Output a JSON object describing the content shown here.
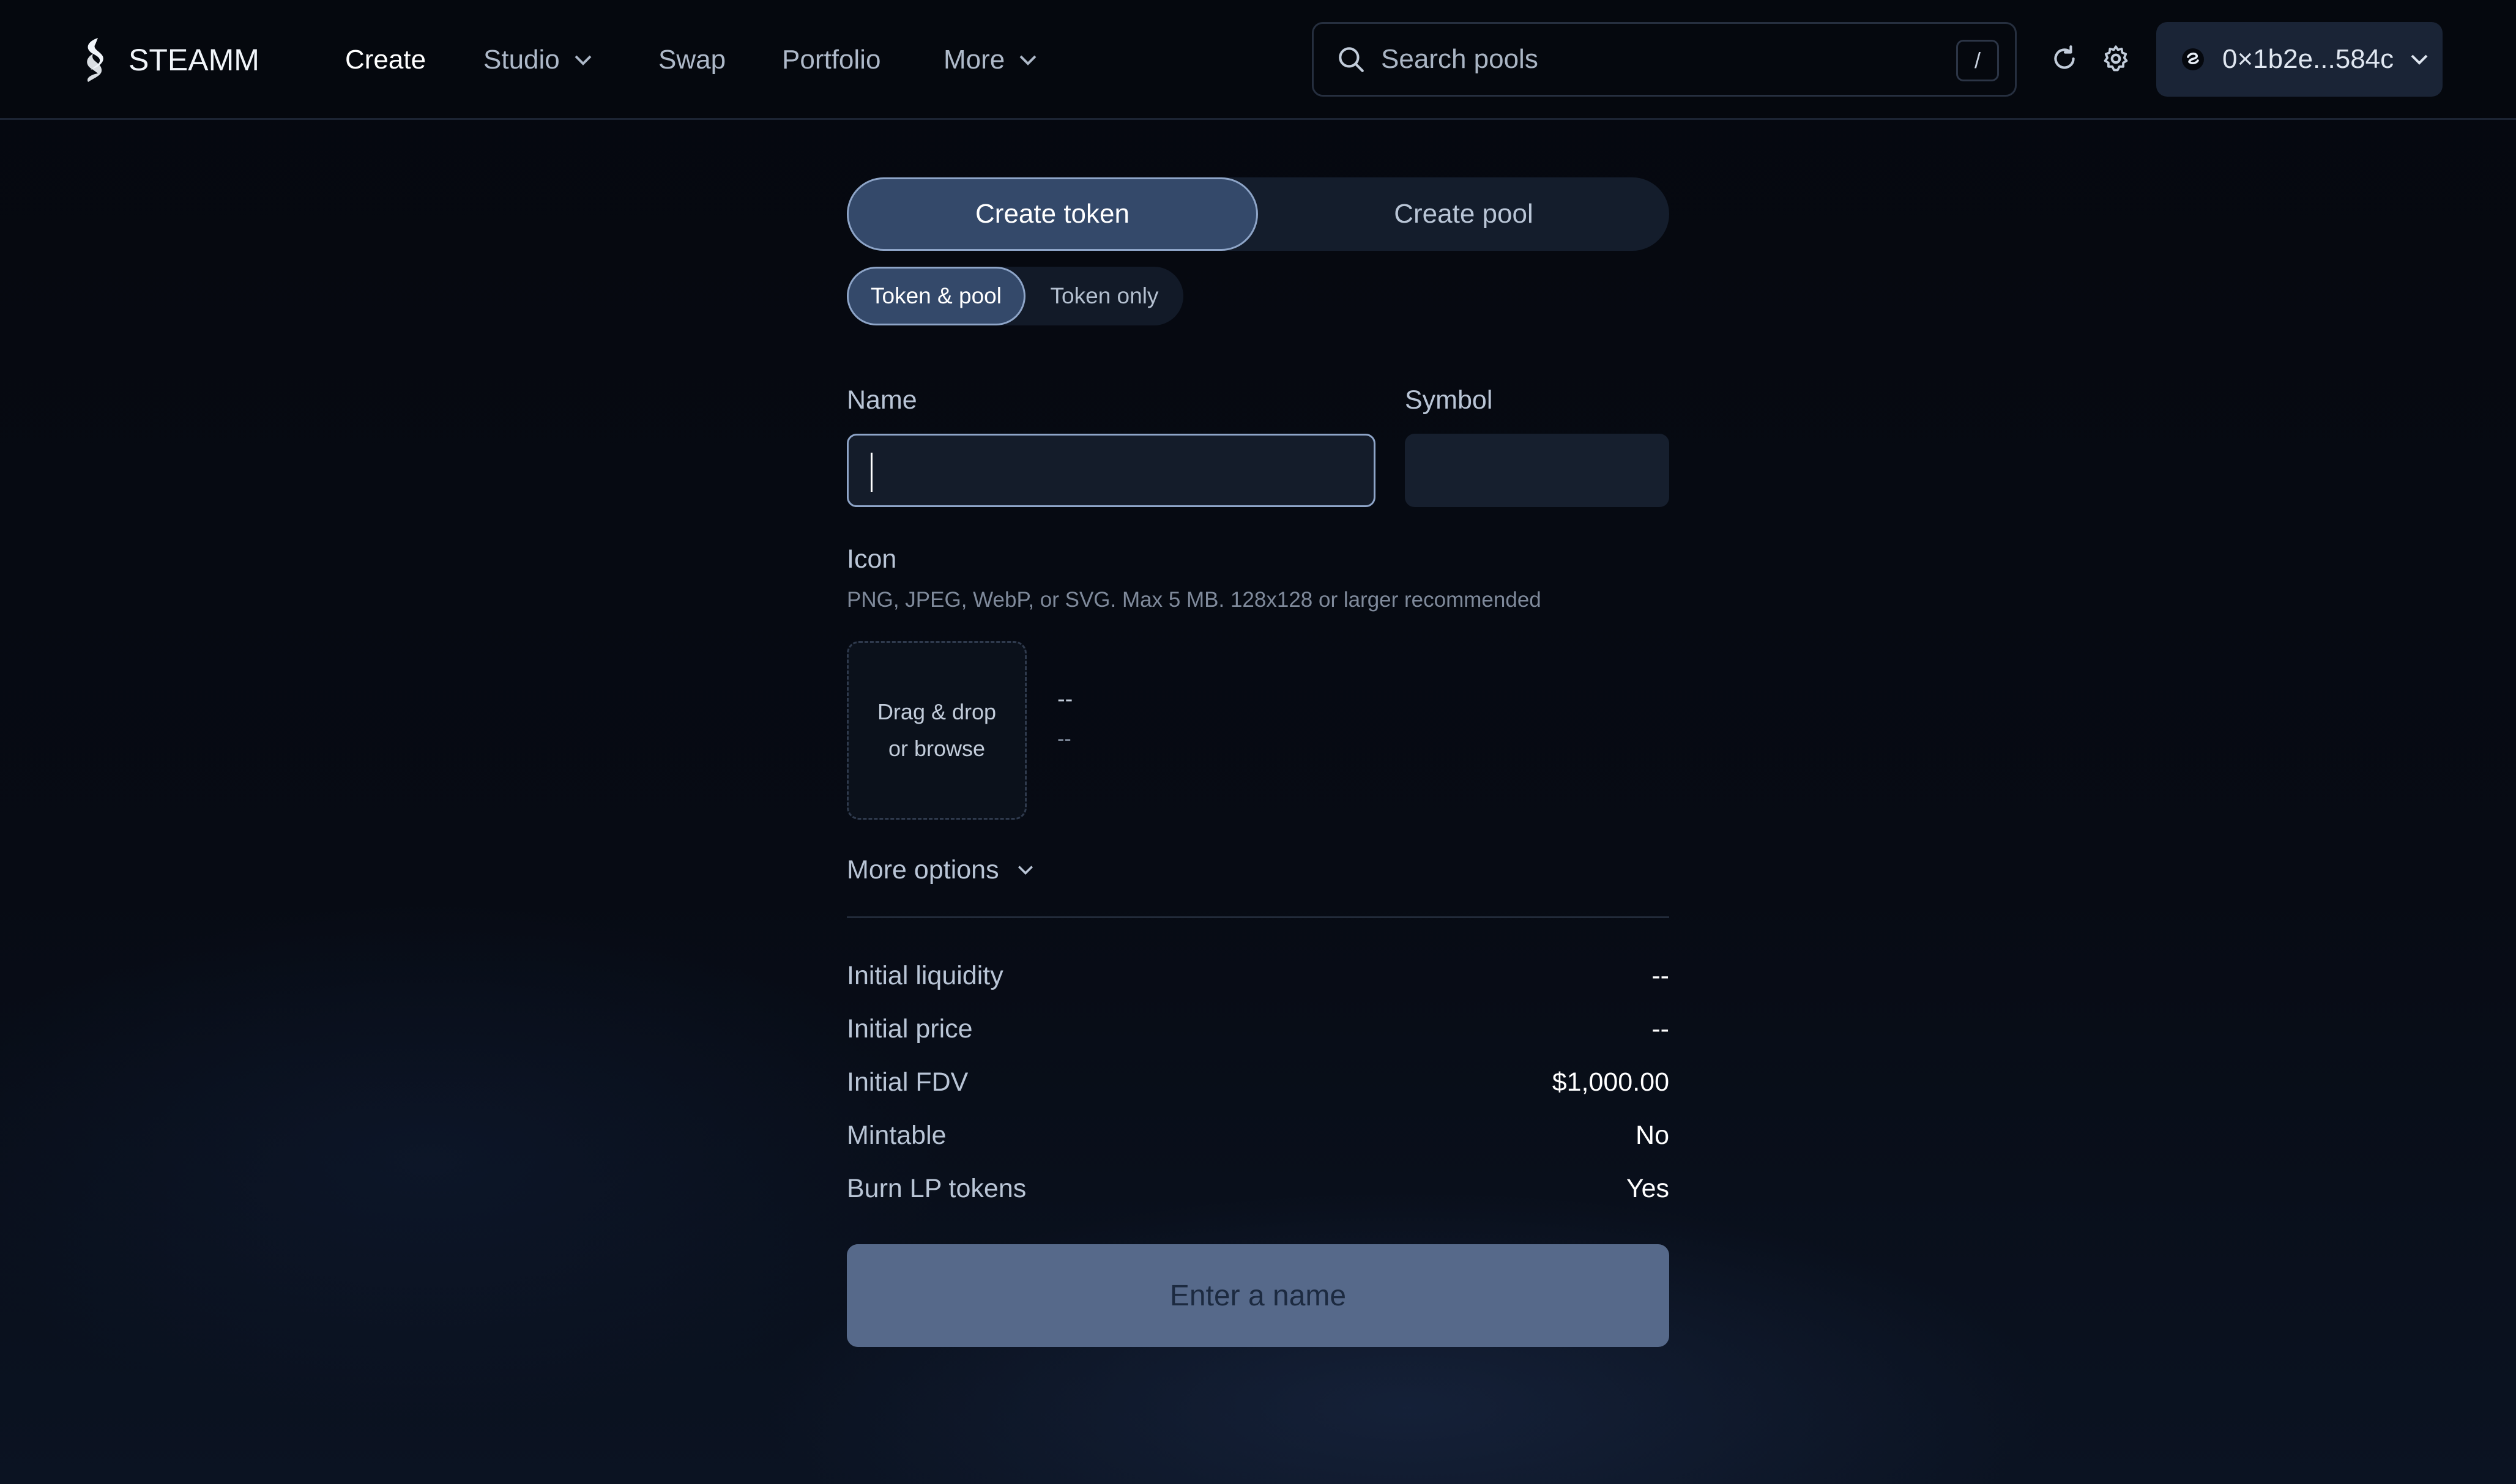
{
  "header": {
    "brand": "STEAMM",
    "nav": [
      {
        "label": "Create"
      },
      {
        "label": "Studio"
      },
      {
        "label": "Swap"
      },
      {
        "label": "Portfolio"
      },
      {
        "label": "More"
      }
    ],
    "search_placeholder": "Search pools",
    "search_shortcut": "/",
    "wallet_address": "0×1b2e...584c"
  },
  "main": {
    "tabs": [
      {
        "label": "Create token"
      },
      {
        "label": "Create pool"
      }
    ],
    "subtabs": [
      {
        "label": "Token & pool"
      },
      {
        "label": "Token only"
      }
    ],
    "name_label": "Name",
    "name_value": "",
    "symbol_label": "Symbol",
    "symbol_value": "",
    "icon_label": "Icon",
    "icon_hint": "PNG, JPEG, WebP, or SVG. Max 5 MB. 128x128 or larger recommended",
    "dropzone_line1": "Drag & drop",
    "dropzone_line2": "or browse",
    "file_name": "--",
    "file_size": "--",
    "more_options": "More options",
    "summary": [
      {
        "label": "Initial liquidity",
        "value": "--"
      },
      {
        "label": "Initial price",
        "value": "--"
      },
      {
        "label": "Initial FDV",
        "value": "$1,000.00"
      },
      {
        "label": "Mintable",
        "value": "No"
      },
      {
        "label": "Burn LP tokens",
        "value": "Yes"
      }
    ],
    "submit_label": "Enter a name"
  }
}
